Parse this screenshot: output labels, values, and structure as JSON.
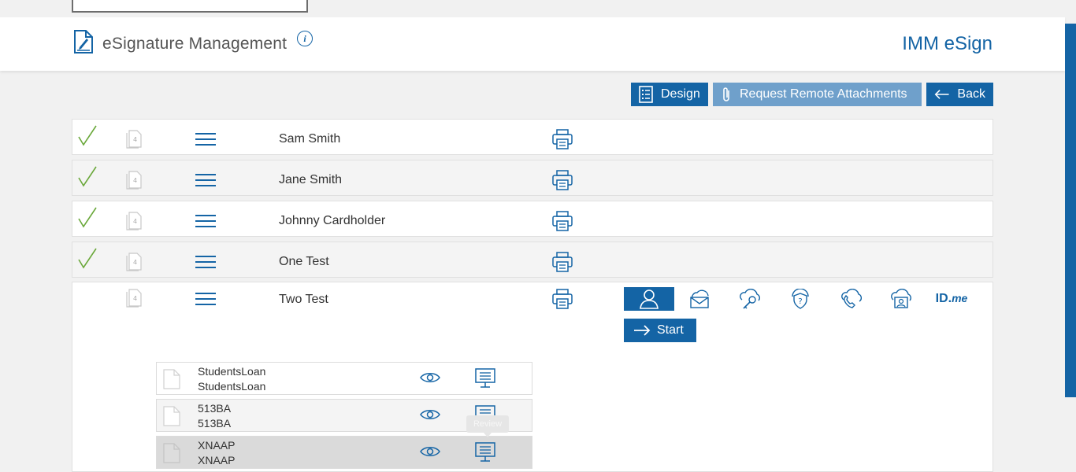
{
  "header": {
    "title": "eSignature Management",
    "info_glyph": "i",
    "brand": "IMM eSign"
  },
  "toolbar": {
    "design_label": "Design",
    "request_label": "Request Remote Attachments",
    "back_label": "Back"
  },
  "signers": [
    {
      "name": "Sam Smith",
      "completed": true,
      "page_count": "4"
    },
    {
      "name": "Jane Smith",
      "completed": true,
      "page_count": "4"
    },
    {
      "name": "Johnny Cardholder",
      "completed": true,
      "page_count": "4"
    },
    {
      "name": "One Test",
      "completed": true,
      "page_count": "4"
    }
  ],
  "expanded_signer": {
    "name": "Two Test",
    "page_count": "4",
    "auth_methods": [
      "person-icon",
      "email-icon",
      "cloud-key-icon",
      "shield-question-icon",
      "phone-icon",
      "cloud-id-icon",
      "idme-logo"
    ],
    "idme_text": "ID.",
    "idme_suffix": "me",
    "start_label": "Start",
    "documents": [
      {
        "line1": "StudentsLoan",
        "line2": "StudentsLoan"
      },
      {
        "line1": "513BA",
        "line2": "513BA"
      },
      {
        "line1": "XNAAP",
        "line2": "XNAAP"
      }
    ],
    "tooltip": "Review"
  },
  "colors": {
    "accent": "#1464a5",
    "accent_disabled": "#6fa0cb",
    "check": "#6aa83a"
  }
}
